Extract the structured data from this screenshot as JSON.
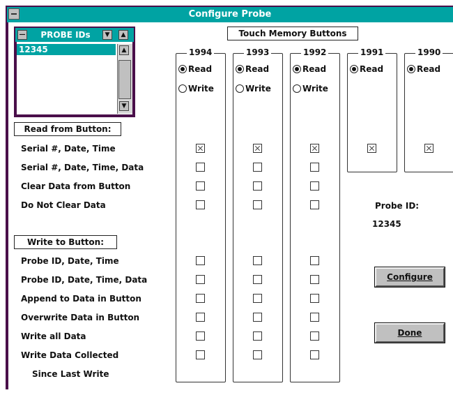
{
  "window": {
    "title": "Configure Probe"
  },
  "probe_ids": {
    "title": "PROBE IDs",
    "items": [
      "12345"
    ],
    "selected": "12345"
  },
  "touch_memory_label": "Touch Memory Buttons",
  "read_section": {
    "label": "Read from Button:",
    "options": [
      "Serial #, Date, Time",
      "Serial #, Date, Time, Data",
      "Clear Data from Button",
      "Do Not Clear Data"
    ]
  },
  "write_section": {
    "label": "Write to Button:",
    "options": [
      "Probe ID, Date, Time",
      "Probe ID, Date, Time, Data",
      "Append to Data in Button",
      "Overwrite Data in Button",
      "Write all Data",
      "Write Data Collected",
      "Since Last Write"
    ]
  },
  "radio_labels": {
    "read": "Read",
    "write": "Write"
  },
  "columns": [
    {
      "year": "1994",
      "mode": "Read",
      "has_write": true,
      "read_checks": [
        true,
        false,
        false,
        false
      ],
      "write_checks": [
        false,
        false,
        false,
        false,
        false,
        false
      ]
    },
    {
      "year": "1993",
      "mode": "Read",
      "has_write": true,
      "read_checks": [
        true,
        false,
        false,
        false
      ],
      "write_checks": [
        false,
        false,
        false,
        false,
        false,
        false
      ]
    },
    {
      "year": "1992",
      "mode": "Read",
      "has_write": true,
      "read_checks": [
        true,
        false,
        false,
        false
      ],
      "write_checks": [
        false,
        false,
        false,
        false,
        false,
        false
      ]
    },
    {
      "year": "1991",
      "mode": "Read",
      "has_write": false,
      "read_checks": [
        true
      ],
      "write_checks": []
    },
    {
      "year": "1990",
      "mode": "Read",
      "has_write": false,
      "read_checks": [
        true
      ],
      "write_checks": []
    }
  ],
  "probe_id": {
    "label": "Probe ID:",
    "value": "12345"
  },
  "buttons": {
    "configure": "Configure",
    "done": "Done"
  },
  "colors": {
    "title_bar": "#00a3a3",
    "frame": "#4a0f4a",
    "button_face": "#c0c0c0"
  }
}
